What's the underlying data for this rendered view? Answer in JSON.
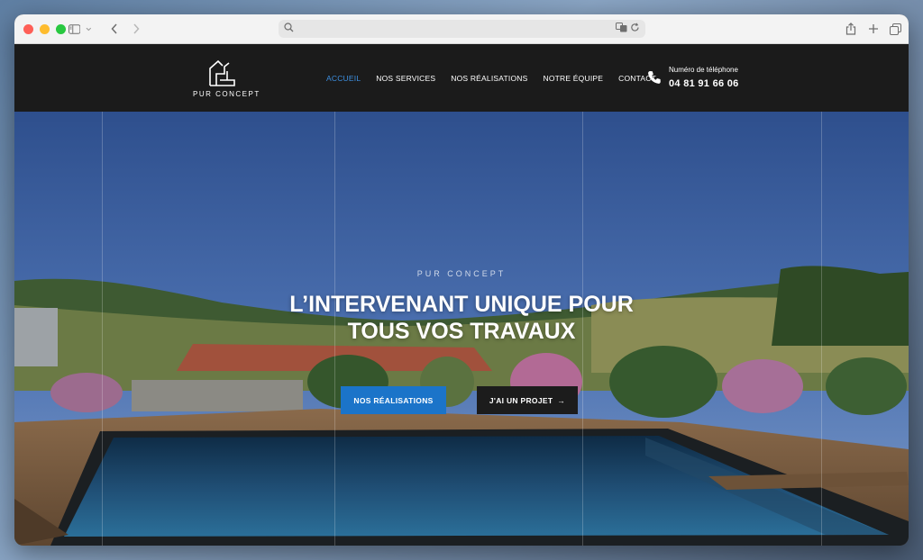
{
  "browser": {
    "address": "",
    "icons": {
      "sidebar": "sidebar-icon",
      "back": "chevron-left-icon",
      "forward": "chevron-right-icon",
      "share": "share-icon",
      "new_tab": "plus-icon",
      "tabs": "tabs-overview-icon"
    }
  },
  "site": {
    "brand": "PUR CONCEPT",
    "nav": [
      {
        "label": "ACCUEIL",
        "active": true
      },
      {
        "label": "NOS SERVICES",
        "active": false
      },
      {
        "label": "NOS RÉALISATIONS",
        "active": false
      },
      {
        "label": "NOTRE ÉQUIPE",
        "active": false
      },
      {
        "label": "CONTACT",
        "active": false
      }
    ],
    "phone": {
      "label": "Numéro de téléphone",
      "number": "04 81 91 66 06"
    },
    "hero": {
      "eyebrow": "PUR CONCEPT",
      "headline_line1": "L’INTERVENANT UNIQUE POUR",
      "headline_line2": "TOUS VOS TRAVAUX",
      "cta_primary": "NOS RÉALISATIONS",
      "cta_secondary": "J'AI UN PROJET",
      "cta_secondary_arrow": "→"
    },
    "colors": {
      "nav_bg": "#1b1b1b",
      "accent": "#1b74c9",
      "active_link": "#3d8fe0"
    }
  }
}
